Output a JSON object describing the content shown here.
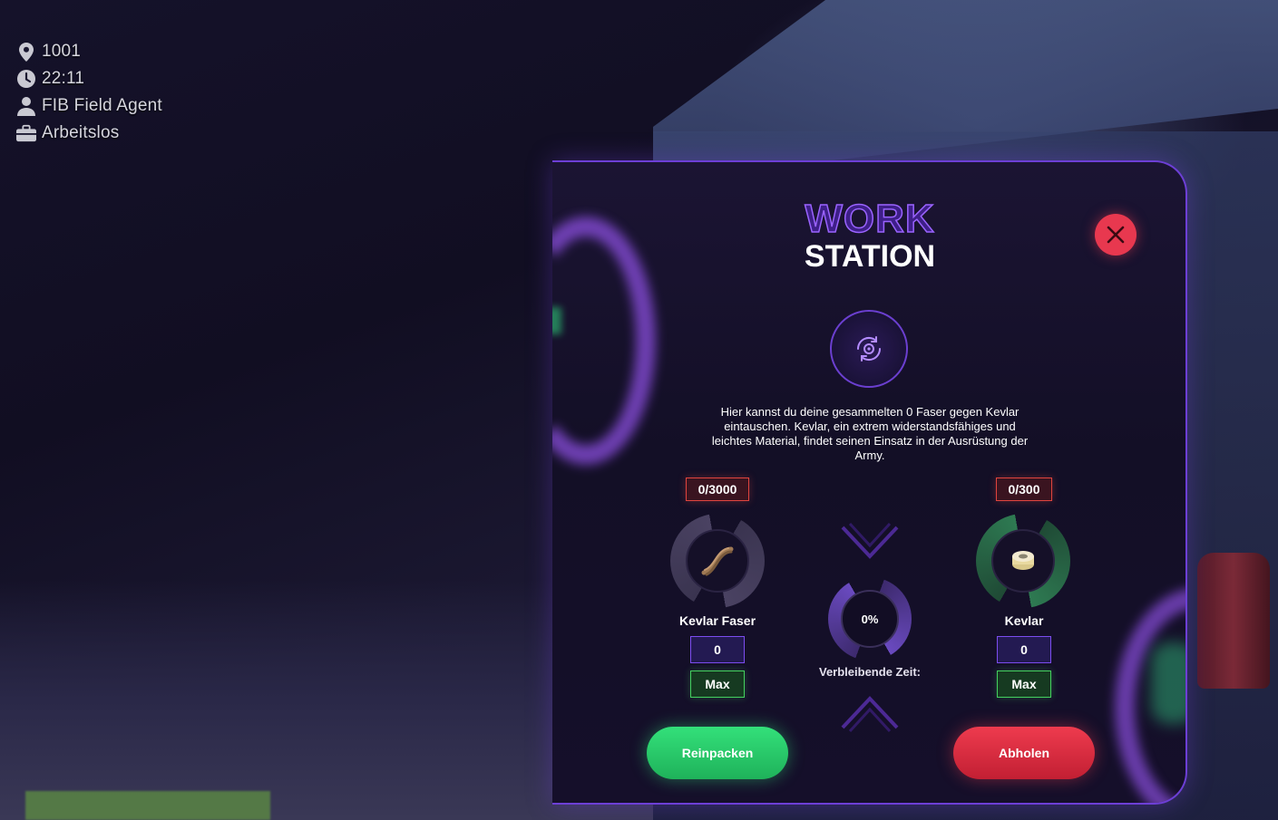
{
  "hud": {
    "location": "1001",
    "time": "22:11",
    "role": "FIB Field Agent",
    "job": "Arbeitslos"
  },
  "panel": {
    "title_line1": "WORK",
    "title_line2": "STATION",
    "description": "Hier kannst du deine gesammelten 0 Faser gegen Kevlar eintauschen. Kevlar, ein extrem widerstandsfähiges und leichtes Material, findet seinen Einsatz in der Ausrüstung der Army.",
    "input_item": {
      "capacity": "0/3000",
      "name": "Kevlar Faser",
      "quantity": "0",
      "max_label": "Max"
    },
    "output_item": {
      "capacity": "0/300",
      "name": "Kevlar",
      "quantity": "0",
      "max_label": "Max"
    },
    "progress": "0%",
    "remaining_label": "Verbleibende Zeit:",
    "pack_button": "Reinpacken",
    "collect_button": "Abholen"
  },
  "colors": {
    "accent_purple": "#7c4df0",
    "close_red": "#e8384f",
    "capacity_border": "#e0443e",
    "max_green": "#44d15f",
    "pack_green": "#2fd26e",
    "collect_red": "#e03046"
  },
  "icons": {
    "location": "map-pin-icon",
    "time": "clock-icon",
    "role": "user-icon",
    "job": "briefcase-icon",
    "close": "close-icon",
    "station": "gear-cycle-icon",
    "fiber": "kevlar-fiber-icon",
    "kevlar": "kevlar-roll-icon"
  }
}
